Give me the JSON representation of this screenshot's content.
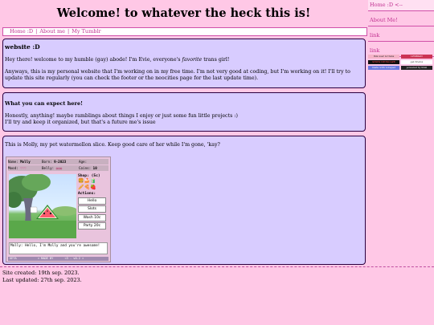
{
  "header": {
    "title": "Welcome! to whatever the heck this is!"
  },
  "topnav": {
    "items": [
      "Home :D",
      "About me",
      "My Tumblr"
    ]
  },
  "sidebar": {
    "items": [
      "Home :D <--",
      "About Me!",
      "link",
      "link"
    ]
  },
  "buttons": [
    {
      "label": "this user is trans",
      "bg": "#f5b3c8",
      "fg": "#222"
    },
    {
      "label": "LESBIAN",
      "bg": "#cc3355",
      "fg": "#fff"
    },
    {
      "label": "SHOW NETSCAPE",
      "bg": "#111111",
      "fg": "#ff4444"
    },
    {
      "label": "get firefox",
      "bg": "#ffffff",
      "fg": "#333"
    },
    {
      "label": "made with notepad",
      "bg": "#6a7ae0",
      "fg": "#fff"
    },
    {
      "label": "powered by html",
      "bg": "#222222",
      "fg": "#fff"
    }
  ],
  "intro": {
    "heading": "website :D",
    "text_before": "Hey there! welcome to my humble (gay) abode! I'm Evie, everyone's ",
    "text_em": "favorite",
    "text_after": " trans girl!",
    "text2": "Anyways, this is my personal website that I'm working on in my free time. I'm not very good at coding, but I'm working on it! I'll try to update this site regularly (you can check the footer or the neocities page for the last update time)."
  },
  "expect": {
    "heading": "What you can expect here!",
    "line1": "Honestly, anything! maybe ramblings about things I enjoy or just some fun little projects :)",
    "line2": "I'll try and keep it organized, but that's a future me's issue"
  },
  "pet": {
    "caption": "This is Molly, my pet watermellon slice. Keep good care of her while I'm gone, 'kay?",
    "name_label": "Name:",
    "name": "Molly",
    "born_label": "Born:",
    "born": "9-2023",
    "age_label": "Age:",
    "age": "",
    "mood_label": "Mood:",
    "mood": "♡♡♡",
    "belly_label": "Belly:",
    "belly": "◍◍◍",
    "coins_label": "Coins:",
    "coins": "10",
    "shop_label": "Shop: (5c)",
    "actions_label": "Actions:",
    "actions": [
      "Hello",
      "Slots",
      "Wash 10c",
      "Party 20c"
    ],
    "chat": "Molly: Hello, I'm Molly and you're awesome!",
    "footer_left": "GETA",
    "footer_mid": "» MADE BY",
    "footer_right": "<3 - v0.2 «"
  },
  "footer": {
    "created": "Site created: 19th sep. 2023.",
    "updated": "Last updated: 27th sep. 2023."
  }
}
